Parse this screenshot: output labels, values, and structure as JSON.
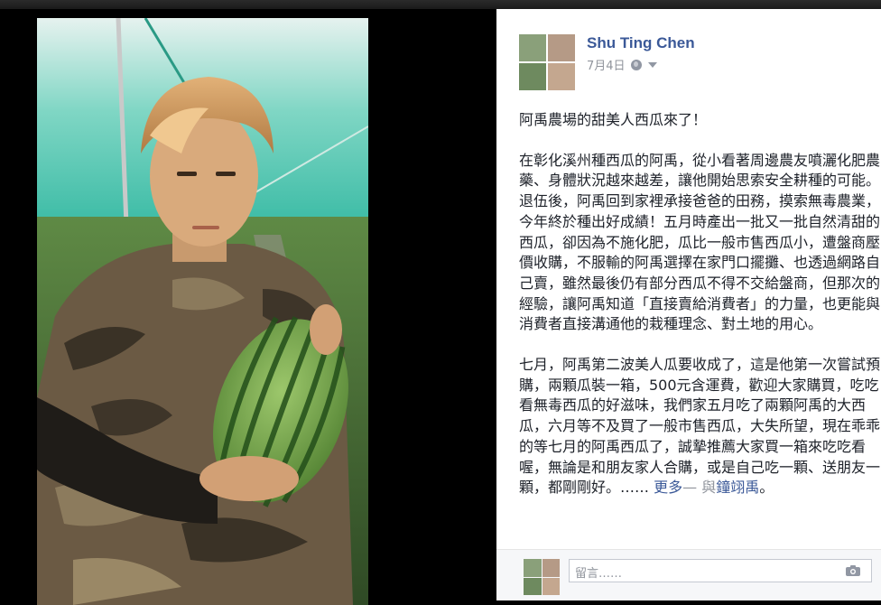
{
  "post": {
    "author": "Shu Ting Chen",
    "date": "7月4日",
    "privacy_icon": "globe-icon",
    "paragraphs": [
      "阿禹農場的甜美人西瓜來了！",
      "在彰化溪州種西瓜的阿禹，從小看著周邊農友噴灑化肥農藥、身體狀況越來越差，讓他開始思索安全耕種的可能。退伍後，阿禹回到家裡承接爸爸的田務，摸索無毒農業，今年終於種出好成績！五月時產出一批又一批自然清甜的西瓜，卻因為不施化肥，瓜比一般市售西瓜小，遭盤商壓價收購，不服輸的阿禹選擇在家門口擺攤、也透過網路自己賣，雖然最後仍有部分西瓜不得不交給盤商，但那次的經驗，讓阿禹知道「直接賣給消費者」的力量，也更能與消費者直接溝通他的栽種理念、對土地的用心。",
      "七月，阿禹第二波美人瓜要收成了，這是他第一次嘗試預購，兩顆瓜裝一箱，500元含運費，歡迎大家購買，吃吃看無毒西瓜的好滋味，我們家五月吃了兩顆阿禹的大西瓜，六月等不及買了一般市售西瓜，大失所望，現在乖乖的等七月的阿禹西瓜了，誠摯推薦大家買一箱來吃吃看喔，無論是和朋友家人合購，或是自己吃一顆、送朋友一顆，都剛剛好。……"
    ],
    "more_label": "更多",
    "with_sep": "— 與",
    "tagged_name": "鐘翊禹",
    "tail": "。"
  },
  "comment": {
    "placeholder": "留言……",
    "camera_icon": "camera-icon"
  },
  "colors": {
    "link": "#3b5998",
    "text": "#1d2129",
    "muted": "#90949c"
  }
}
